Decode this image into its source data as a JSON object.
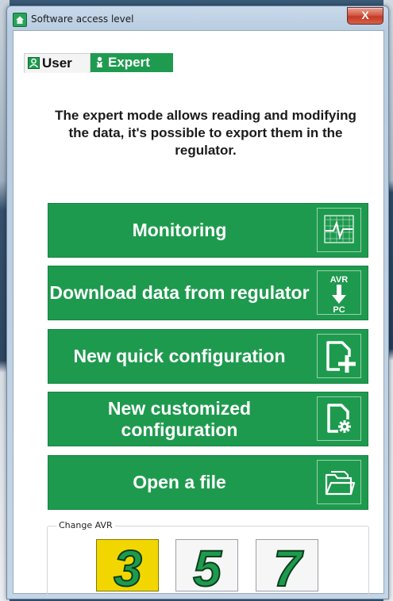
{
  "window": {
    "title": "Software access level",
    "close_label": "X"
  },
  "tabs": [
    {
      "label": "User",
      "icon": "user-icon",
      "active": false
    },
    {
      "label": "Expert",
      "icon": "expert-icon",
      "active": true
    }
  ],
  "description": "The expert mode allows reading and modifying the data, it's possible to export them in the regulator.",
  "actions": [
    {
      "label": "Monitoring",
      "icon": "monitoring-chart-icon"
    },
    {
      "label": "Download data from regulator",
      "icon": "avr-to-pc-icon",
      "icon_text_top": "AVR",
      "icon_text_bottom": "PC"
    },
    {
      "label": "New quick configuration",
      "icon": "new-document-plus-icon"
    },
    {
      "label": "New customized configuration",
      "icon": "document-gear-icon"
    },
    {
      "label": "Open a file",
      "icon": "open-folder-icon"
    }
  ],
  "change_avr": {
    "legend": "Change AVR",
    "options": [
      {
        "label": "3",
        "selected": true
      },
      {
        "label": "5",
        "selected": false
      },
      {
        "label": "7",
        "selected": false
      }
    ]
  },
  "colors": {
    "accent_green": "#1e9a4e",
    "selected_yellow": "#f2d600",
    "digit_green": "#1e9a4e"
  }
}
